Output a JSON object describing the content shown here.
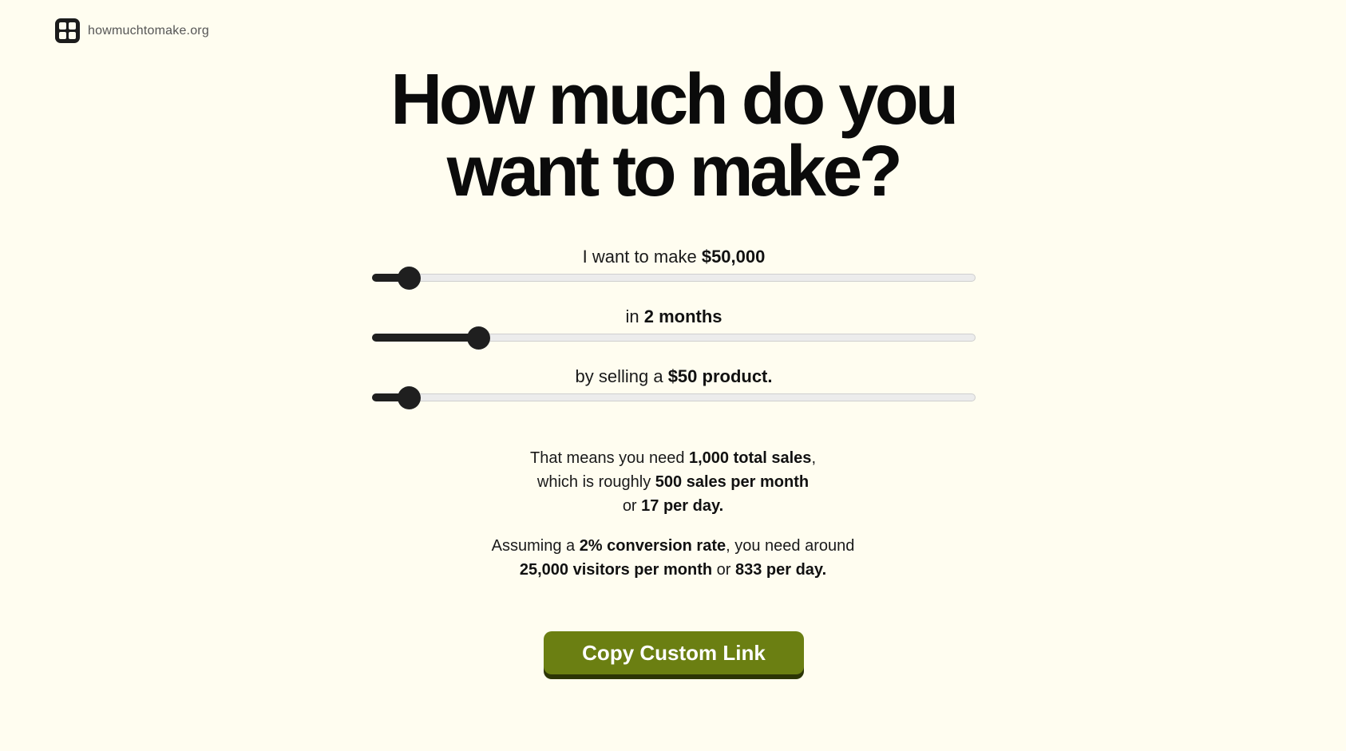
{
  "brand": {
    "name": "howmuchtomake.org",
    "logo_icon": "calculator-icon"
  },
  "headline": {
    "line1": "How much do you",
    "line2": "want to make?"
  },
  "sliders": {
    "income": {
      "prefix": "I want to make ",
      "value": "$50,000",
      "suffix": "",
      "fraction": 0.06
    },
    "duration": {
      "prefix": "in ",
      "value": "2 months",
      "suffix": "",
      "fraction": 0.175
    },
    "price": {
      "prefix": "by selling a ",
      "value": "$50 product.",
      "suffix": "",
      "fraction": 0.06
    }
  },
  "result": {
    "p1_a": "That means you need ",
    "total_sales": "1,000 total sales",
    "p1_b": ",",
    "p1_c": "which is roughly ",
    "sales_per_month": "500 sales per month",
    "p1_d": "or ",
    "per_day": "17 per day.",
    "p2_a": "Assuming a ",
    "conversion_rate": "2% conversion rate",
    "p2_b": ", you need around",
    "visitors_per_month": "25,000 visitors per month",
    "p2_c": " or ",
    "visitors_per_day": "833 per day."
  },
  "cta": {
    "label": "Copy Custom Link"
  },
  "colors": {
    "background": "#fffdf0",
    "accent": "#6b7f12",
    "slider": "#1f1f1f"
  }
}
